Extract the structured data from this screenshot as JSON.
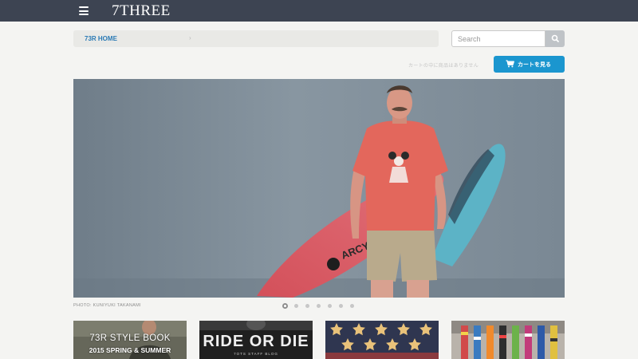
{
  "header": {
    "logo": "7THREE",
    "menu_icon": "hamburger-menu-icon"
  },
  "breadcrumb": {
    "home_label": "73R HOME",
    "separator": "›"
  },
  "search": {
    "placeholder": "Search",
    "value": "",
    "icon": "search-icon"
  },
  "cart": {
    "status_text": "カートの中に商品はありません",
    "button_label": "カートを見る",
    "icon": "cart-icon"
  },
  "hero": {
    "photo_credit": "PHOTO: KUNIYUKI TAKANAMI",
    "slide_count": 7,
    "active_slide": 1
  },
  "thumbnails": [
    {
      "title": "73R STYLE BOOK",
      "subtitle": "2015 SPRING & SUMMER"
    },
    {
      "title": "RIDE OR DIE",
      "subtitle": "7OTS STAFF BLOG"
    },
    {
      "title": "",
      "subtitle": ""
    },
    {
      "title": "",
      "subtitle": ""
    }
  ],
  "colors": {
    "topbar": "#3d4452",
    "accent": "#1b96cf",
    "link": "#2a7ab5",
    "background": "#f4f4f2"
  }
}
